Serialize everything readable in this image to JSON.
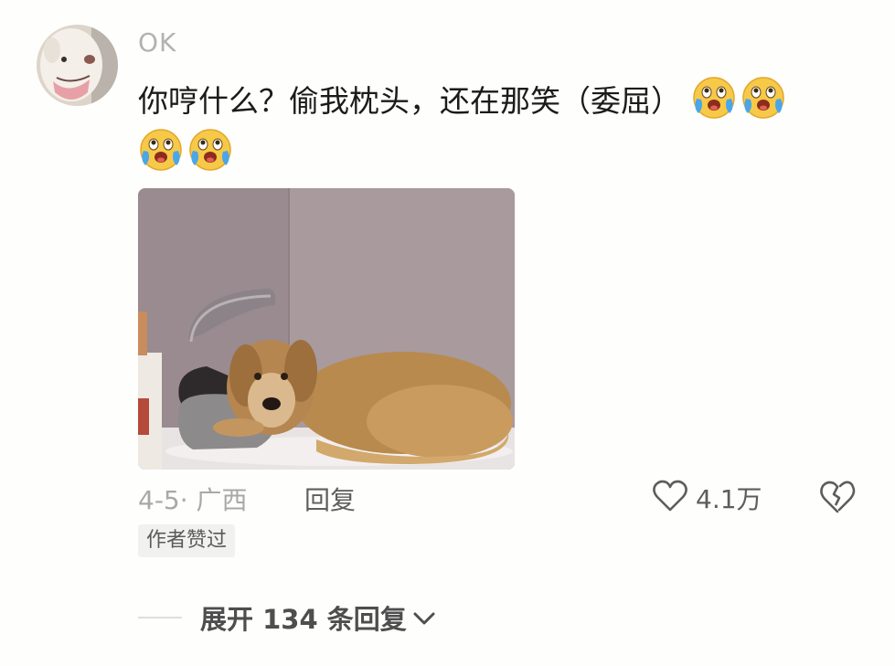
{
  "comment": {
    "username": "OK",
    "text": "你哼什么？偷我枕头，还在那笑（委屈）",
    "emoji_names": [
      "crying-face-emoji",
      "crying-face-emoji",
      "crying-face-emoji",
      "crying-face-emoji"
    ]
  },
  "meta": {
    "date_location": "4-5· 广西",
    "reply_label": "回复",
    "like_count": "4.1万",
    "author_liked_badge": "作者赞过"
  },
  "replies": {
    "expand_label": "展开 134 条回复"
  },
  "icons": {
    "like": "heart-outline-icon",
    "dislike": "broken-heart-icon",
    "expand": "chevron-down-icon"
  },
  "colors": {
    "background": "#fefefc",
    "text_primary": "#1b1b1b",
    "text_secondary": "#a8a8a8",
    "emoji_yellow": "#f7c948",
    "tear_blue": "#4aa6e8"
  }
}
